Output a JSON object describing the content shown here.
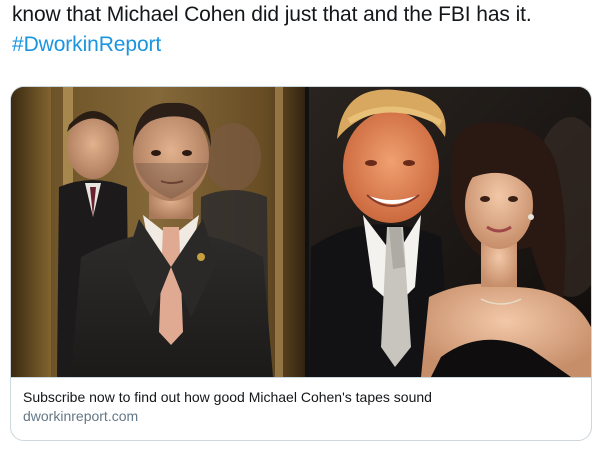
{
  "tweet": {
    "text_line1": "know that Michael Cohen did just that and the FBI has it.",
    "hashtag": "#DworkinReport"
  },
  "card": {
    "image_icon": "photo-collage",
    "title": "Subscribe now to find out how good Michael Cohen's tapes sound",
    "domain": "dworkinreport.com"
  },
  "colors": {
    "hashtag": "#1b95e0",
    "text": "#14171a",
    "secondary_text": "#657786",
    "border": "#ccd6dd"
  }
}
